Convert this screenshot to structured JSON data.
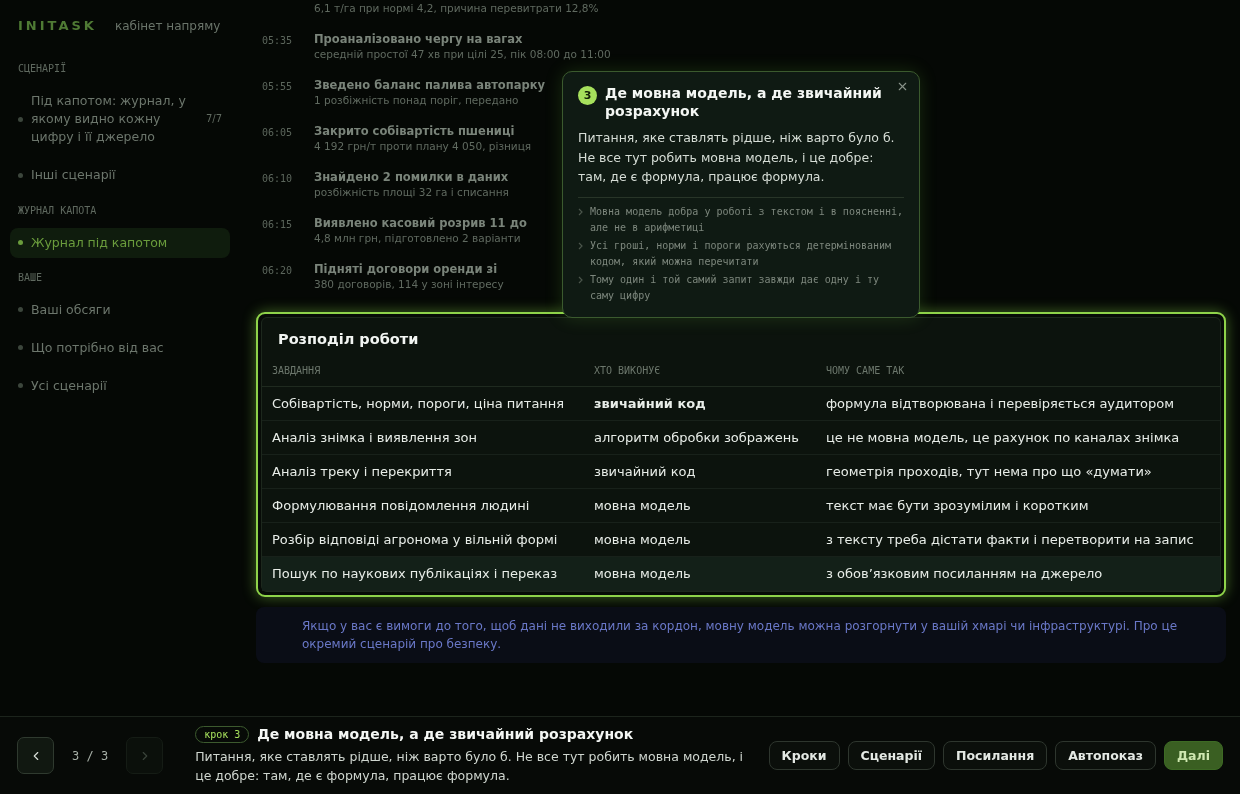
{
  "sidebar": {
    "brand": "INITASK",
    "subtitle": "кабінет напряму",
    "sections": [
      {
        "title": "СЦЕНАРІЇ",
        "items": [
          {
            "label": "Під капотом: журнал, у якому видно кожну цифру і її джерело",
            "count": "7/7",
            "selected": false
          },
          {
            "label": "Інші сценарії",
            "selected": false
          }
        ]
      },
      {
        "title": "ЖУРНАЛ КАПОТА",
        "items": [
          {
            "label": "Журнал під капотом",
            "selected": true
          }
        ]
      },
      {
        "title": "ВАШЕ",
        "items": [
          {
            "label": "Ваші обсяги",
            "selected": false
          },
          {
            "label": "Що потрібно від вас",
            "selected": false
          },
          {
            "label": "Усі сценарії",
            "selected": false
          }
        ]
      }
    ]
  },
  "log": [
    {
      "note": "6,1 т/га при нормі 4,2, причина перевитрати 12,8%"
    },
    {
      "time": "05:35",
      "title": "Проаналізовано чергу на вагах",
      "note": "середній простої 47 хв при цілі 25, пік 08:00 до 11:00"
    },
    {
      "time": "05:55",
      "title": "Зведено баланс палива автопарку",
      "note": "1 розбіжність понад поріг, передано"
    },
    {
      "time": "06:05",
      "title": "Закрито собівартість пшениці",
      "note": "4 192 грн/т проти плану 4 050, різниця"
    },
    {
      "time": "06:10",
      "title": "Знайдено 2 помилки в даних",
      "note": "розбіжність площі 32 га і списання"
    },
    {
      "time": "06:15",
      "title": "Виявлено касовий розрив 11 до",
      "note": "4,8 млн грн, підготовлено 2 варіанти"
    },
    {
      "time": "06:20",
      "title": "Підняті договори оренди зі",
      "note": "380 договорів, 114 у зоні інтересу"
    }
  ],
  "work_split": {
    "title": "Розподіл роботи",
    "columns": [
      "ЗАВДАННЯ",
      "ХТО ВИКОНУЄ",
      "ЧОМУ САМЕ ТАК"
    ],
    "rows": [
      {
        "task": "Собівартість, норми, пороги, ціна питання",
        "who": "звичайний код",
        "who_bold": true,
        "why": "формула відтворювана і перевіряється аудитором",
        "highlighted": false
      },
      {
        "task": "Аналіз знімка і виявлення зон",
        "who": "алгоритм обробки зображень",
        "who_bold": false,
        "why": "це не мовна модель, це рахунок по каналах знімка",
        "highlighted": false
      },
      {
        "task": "Аналіз треку і перекриття",
        "who": "звичайний код",
        "who_bold": false,
        "why": "геометрія проходів, тут нема про що «думати»",
        "highlighted": false
      },
      {
        "task": "Формулювання повідомлення людині",
        "who": "мовна модель",
        "who_bold": false,
        "why": "текст має бути зрозумілим і коротким",
        "highlighted": false
      },
      {
        "task": "Розбір відповіді агронома у вільній формі",
        "who": "мовна модель",
        "who_bold": false,
        "why": "з тексту треба дістати факти і перетворити на запис",
        "highlighted": false
      },
      {
        "task": "Пошук по наукових публікаціях і переказ",
        "who": "мовна модель",
        "who_bold": false,
        "why": "з обов’язковим посиланням на джерело",
        "highlighted": true
      }
    ]
  },
  "note": "Якщо у вас є вимоги до того, щоб дані не виходили за кордон, мовну модель можна розгорнути у вашій хмарі чи інфраструктурі. Про це окремий сценарій про безпеку.",
  "popover": {
    "step": "3",
    "title": "Де мовна модель, а де звичайний розрахунок",
    "text": "Питання, яке ставлять рідше, ніж варто було б. Не все тут робить мовна модель, і це добре: там, де є формула, працює формула.",
    "points": [
      "Мовна модель добра у роботі з текстом і в поясненні, але не в арифметиці",
      "Усі гроші, норми і пороги рахуються детермінованим кодом, який можна перечитати",
      "Тому один і той самий запит завжди дає одну і ту саму цифру"
    ]
  },
  "tour": {
    "prev_disabled": false,
    "next_disabled": true,
    "counter": "3 / 3",
    "badge": "крок 3",
    "title": "Де мовна модель, а де звичайний розрахунок",
    "text": "Питання, яке ставлять рідше, ніж варто було б. Не все тут робить мовна модель, і це добре: там, де є формула, працює формула.",
    "buttons": [
      {
        "label": "Кроки",
        "primary": false
      },
      {
        "label": "Сценарії",
        "primary": false
      },
      {
        "label": "Посилання",
        "primary": false
      },
      {
        "label": "Автопоказ",
        "primary": false
      },
      {
        "label": "Далі",
        "primary": true
      }
    ]
  }
}
